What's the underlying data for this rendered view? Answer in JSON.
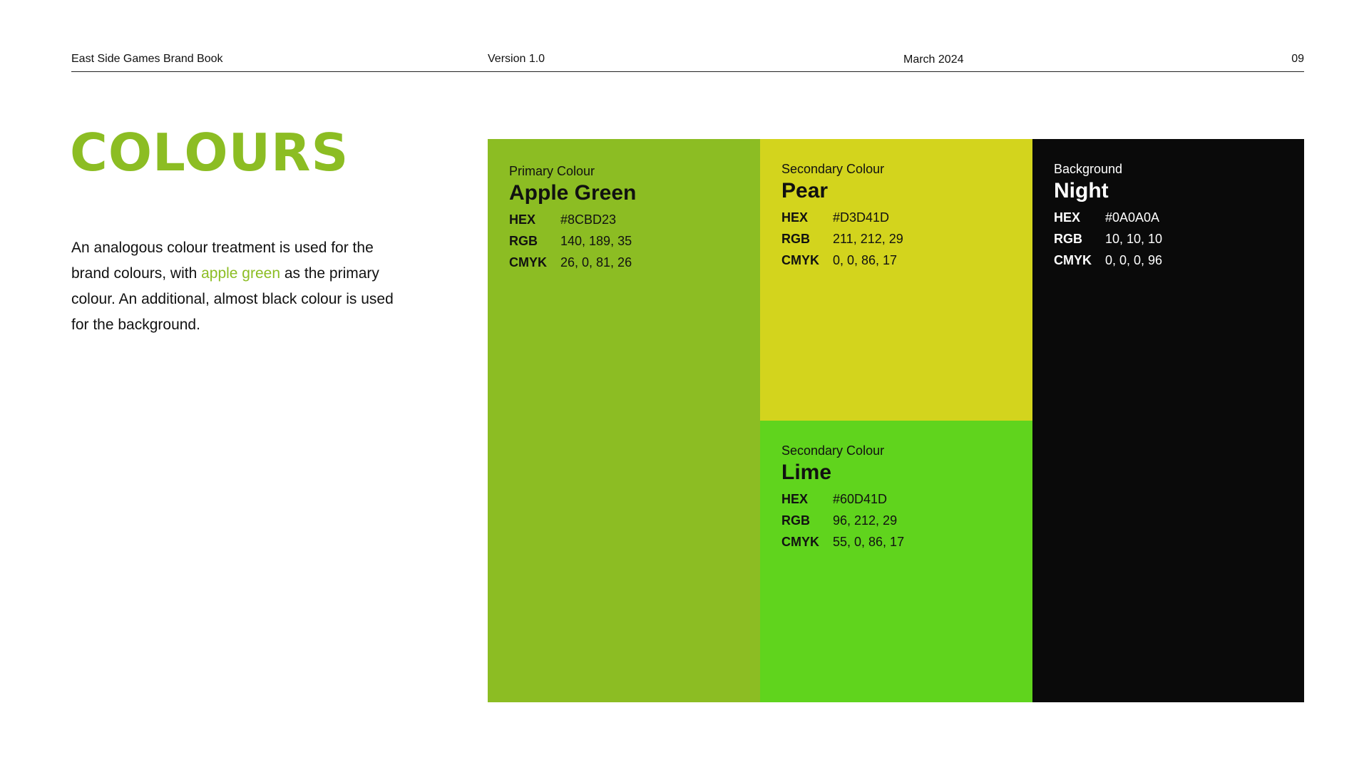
{
  "header": {
    "title": "East Side Games Brand Book",
    "version": "Version 1.0",
    "date": "March 2024",
    "page": "09"
  },
  "title": "COLOURS",
  "intro": {
    "before": "An analogous colour treatment is used for the brand colours, with ",
    "highlight": "apple green",
    "after": " as the primary colour. An additional, almost black colour is used for the background."
  },
  "colors": {
    "apple_green": "#8CBD23",
    "pear": "#D3D41D",
    "lime": "#60D41D",
    "night": "#0A0A0A"
  },
  "swatches": [
    {
      "kind": "Primary Colour",
      "name": "Apple Green",
      "hex_label": "HEX",
      "hex": "#8CBD23",
      "rgb_label": "RGB",
      "rgb": "140, 189, 35",
      "cmyk_label": "CMYK",
      "cmyk": "26, 0, 81, 26"
    },
    {
      "kind": "Secondary Colour",
      "name": "Pear",
      "hex_label": "HEX",
      "hex": "#D3D41D",
      "rgb_label": "RGB",
      "rgb": "211, 212, 29",
      "cmyk_label": "CMYK",
      "cmyk": "0, 0, 86, 17"
    },
    {
      "kind": "Secondary Colour",
      "name": "Lime",
      "hex_label": "HEX",
      "hex": "#60D41D",
      "rgb_label": "RGB",
      "rgb": "96, 212, 29",
      "cmyk_label": "CMYK",
      "cmyk": "55, 0, 86, 17"
    },
    {
      "kind": "Background",
      "name": "Night",
      "hex_label": "HEX",
      "hex": "#0A0A0A",
      "rgb_label": "RGB",
      "rgb": "10, 10, 10",
      "cmyk_label": "CMYK",
      "cmyk": "0, 0, 0, 96"
    }
  ]
}
